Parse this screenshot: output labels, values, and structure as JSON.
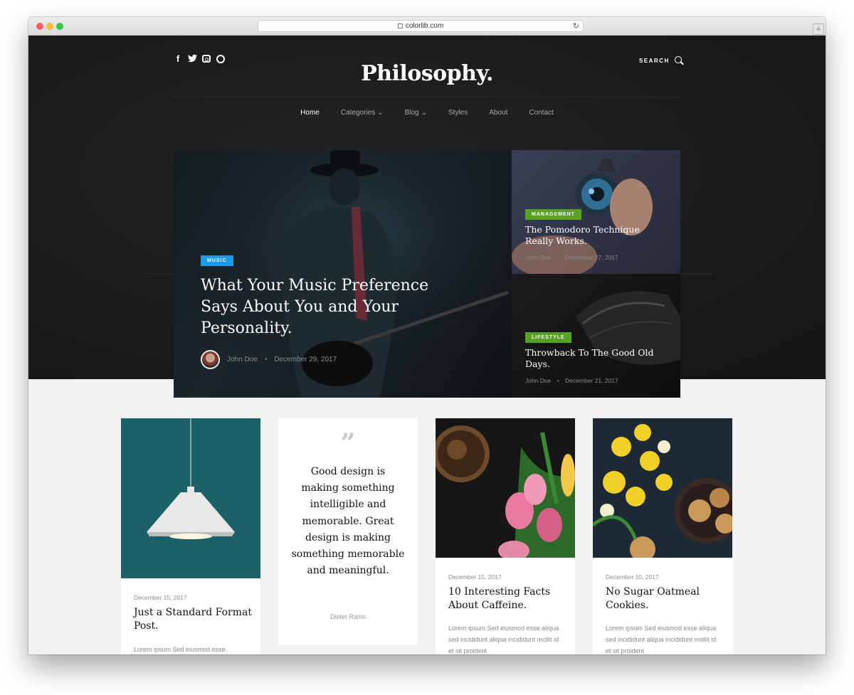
{
  "browser": {
    "url": "colorlib.com"
  },
  "header": {
    "logo": "Philosophy.",
    "search_label": "SEARCH",
    "social_icons": [
      "facebook-icon",
      "twitter-icon",
      "instagram-icon",
      "pinterest-icon"
    ],
    "social_glyphs": {
      "facebook": "f",
      "twitter": "t"
    }
  },
  "nav": {
    "items": [
      {
        "label": "Home",
        "active": true
      },
      {
        "label": "Categories",
        "dropdown": true
      },
      {
        "label": "Blog",
        "dropdown": true
      },
      {
        "label": "Styles"
      },
      {
        "label": "About"
      },
      {
        "label": "Contact"
      }
    ]
  },
  "featured": {
    "main": {
      "category": "MUSIC",
      "category_color": "#1b9bea",
      "title": "What Your Music Preference Says About You and Your Personality.",
      "author": "John Doe",
      "date": "December 29, 2017"
    },
    "side": [
      {
        "category": "MANAGEMENT",
        "category_color": "#5aa025",
        "title": "The Pomodoro Technique Really Works.",
        "author": "John Doe",
        "date": "December 27, 2017"
      },
      {
        "category": "LIFESTYLE",
        "category_color": "#5aa025",
        "title": "Throwback To The Good Old Days.",
        "author": "John Doe",
        "date": "December 21, 2017"
      }
    ]
  },
  "cards": [
    {
      "date": "December 15, 2017",
      "title": "Just a Standard Format Post.",
      "excerpt": "Lorem ipsum Sed eiusmod esse"
    },
    {
      "quote_mark": "”",
      "quote": "Good design is making something intelligible and memorable. Great design is making something memorable and meaningful.",
      "author": "Dieter Rams"
    },
    {
      "date": "December 15, 2017",
      "title": "10 Interesting Facts About Caffeine.",
      "excerpt": "Lorem ipsum Sed eiusmod esse aliqua sed incididunt aliqua incididunt mollit id et sit proident"
    },
    {
      "date": "December 10, 2017",
      "title": "No Sugar Oatmeal Cookies.",
      "excerpt": "Lorem ipsum Sed eiusmod esse aliqua sed incididunt aliqua incididunt mollit id et sit proident"
    }
  ],
  "meta_separator": "•",
  "colors": {
    "hero_bg": "#1a1a1a",
    "page_bg": "#f2f2f2",
    "tag_blue": "#1b9bea",
    "tag_green": "#5aa025"
  }
}
